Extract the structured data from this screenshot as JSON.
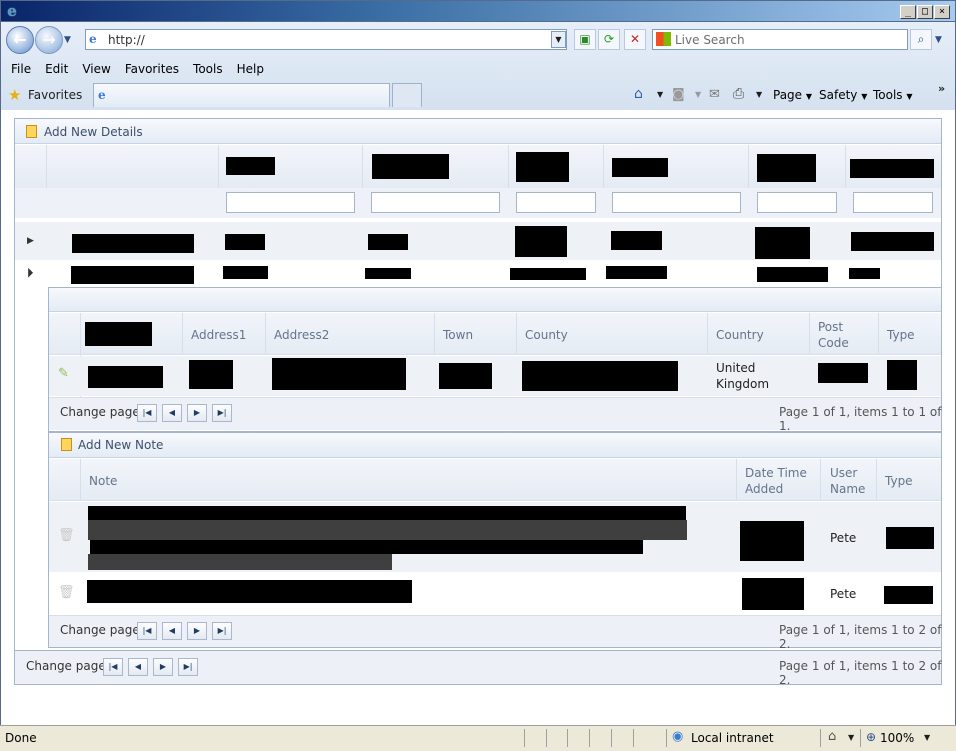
{
  "browser": {
    "address": "http://",
    "search_placeholder": "Live Search",
    "menu": [
      "File",
      "Edit",
      "View",
      "Favorites",
      "Tools",
      "Help"
    ],
    "favorites_label": "Favorites",
    "commands": {
      "page": "Page",
      "safety": "Safety",
      "tools": "Tools"
    },
    "status": {
      "text": "Done",
      "zone": "Local intranet",
      "zoom": "100%"
    }
  },
  "grid": {
    "add_new_label": "Add New Details",
    "pager": {
      "label": "Change page:",
      "summary": "Page 1 of 1, items 1 to 2 of 2."
    },
    "detail": {
      "headers": [
        "Address1",
        "Address2",
        "Town",
        "County",
        "Country",
        "Post Code",
        "Type"
      ],
      "row": {
        "country": "United Kingdom"
      },
      "pager": {
        "label": "Change page:",
        "summary": "Page 1 of 1, items 1 to 1 of 1."
      }
    },
    "notes": {
      "add_new_label": "Add New Note",
      "headers": {
        "note": "Note",
        "date": "Date Time Added",
        "user": "User Name",
        "type": "Type"
      },
      "rows": [
        {
          "user": "Pete"
        },
        {
          "user": "Pete"
        }
      ],
      "pager": {
        "label": "Change page:",
        "summary": "Page 1 of 1, items 1 to 2 of 2."
      }
    }
  }
}
